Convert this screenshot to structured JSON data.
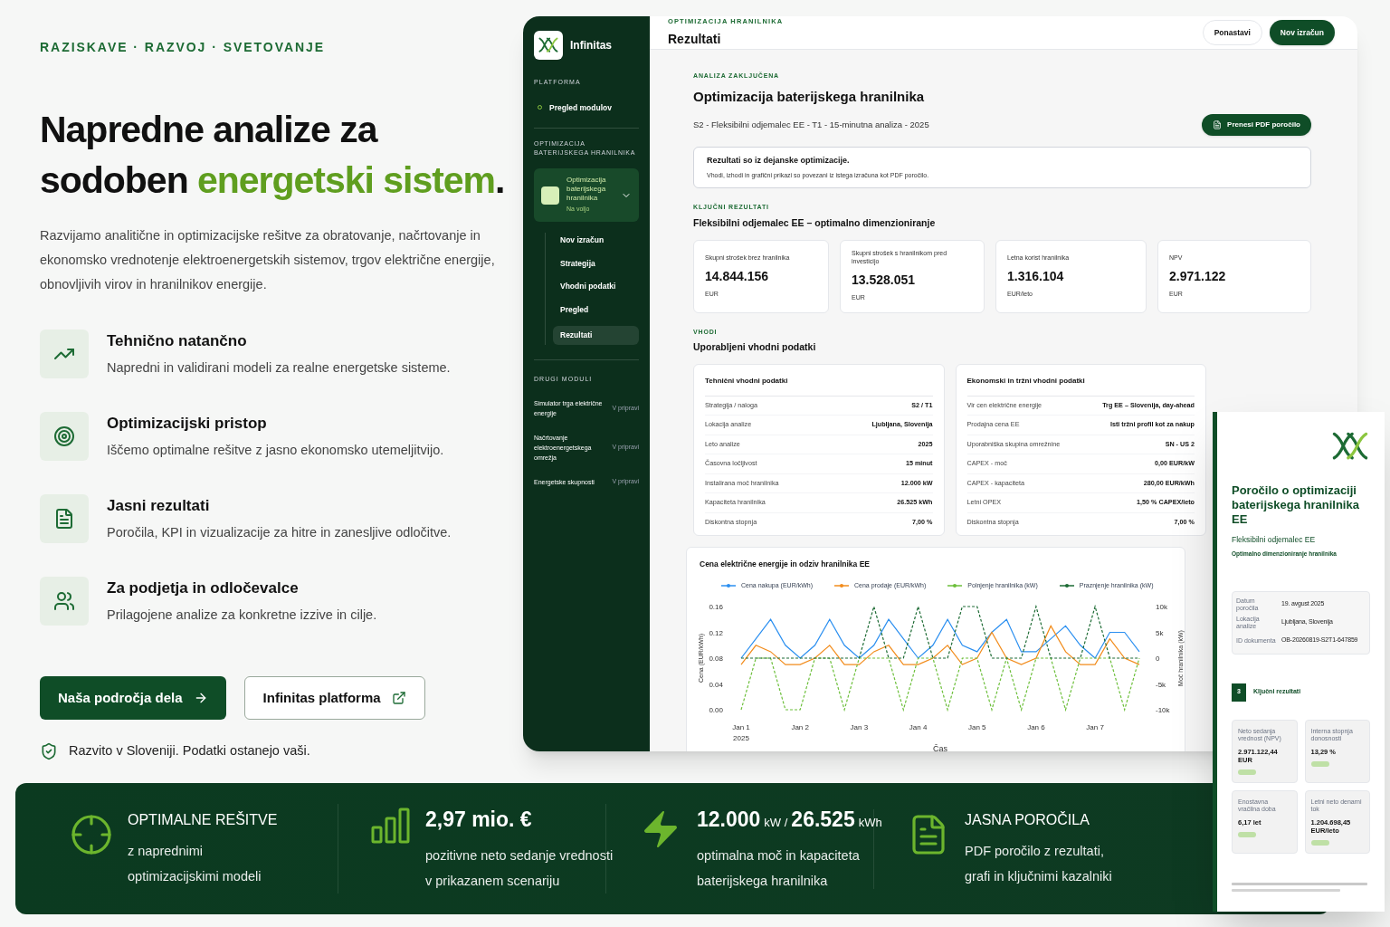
{
  "eyebrow": "RAZISKAVE · RAZVOJ · SVETOVANJE",
  "headline": [
    {
      "text": "Napredne analize za sodoben ",
      "kind": "plain"
    },
    {
      "text": "energetski sistem",
      "kind": "accent"
    },
    {
      "text": ".",
      "kind": "plain"
    }
  ],
  "intro": "Razvijamo analitične in optimizacijske rešitve za obratovanje, načrtovanje in ekonomsko vrednotenje elektroenergetskih sistemov, trgov električne energije, obnovljivih virov in hranilnikov energije.",
  "features": [
    {
      "title": "Tehnično natančno",
      "text": "Napredni in validirani modeli za realne energetske sisteme."
    },
    {
      "title": "Optimizacijski pristop",
      "text": "Iščemo optimalne rešitve z jasno ekonomsko utemeljitvijo."
    },
    {
      "title": "Jasni rezultati",
      "text": "Poročila, KPI in vizualizacije za hitre in zanesljive odločitve."
    },
    {
      "title": "Za podjetja in odločevalce",
      "text": "Prilagojene analize za konkretne izzive in cilje."
    }
  ],
  "buttons": [
    {
      "label": "Naša področja dela",
      "kind": "primary"
    },
    {
      "label": "Infinitas platforma",
      "kind": "secondary"
    }
  ],
  "note": "Razvito v Sloveniji. Podatki ostanejo vaši.",
  "app": {
    "brand": "Infinitas",
    "sidebar": {
      "platform_heading": "PLATFORMA",
      "platform_item": "Pregled modulov",
      "module_heading": "OPTIMIZACIJA BATERIJSKEGA HRANILNIKA",
      "module": {
        "title": "Optimizacija baterijskega hranilnika",
        "status": "Na voljo",
        "expanded": true
      },
      "steps": [
        {
          "label": "Nov izračun",
          "selected": false
        },
        {
          "label": "Strategija",
          "selected": false
        },
        {
          "label": "Vhodni podatki",
          "selected": false
        },
        {
          "label": "Pregled",
          "selected": false
        },
        {
          "label": "Rezultati",
          "selected": true
        }
      ],
      "other_heading": "DRUGI MODULI",
      "other_modules": [
        {
          "label": "Simulator trga električne energije",
          "status": "V pripravi"
        },
        {
          "label": "Načrtovanje elektroenergetskega omrežja",
          "status": "V pripravi"
        },
        {
          "label": "Energetske skupnosti",
          "status": "V pripravi"
        }
      ]
    },
    "header": {
      "eyebrow": "OPTIMIZACIJA HRANILNIKA",
      "title": "Rezultati",
      "buttons": [
        {
          "label": "Ponastavi",
          "kind": "secondary"
        },
        {
          "label": "Nov izračun",
          "kind": "primary"
        }
      ]
    },
    "status_label": "ANALIZA ZAKLJUČENA",
    "title": "Optimizacija baterijskega hranilnika",
    "subtitle": "S2 - Fleksibilni odjemalec EE - T1 - 15-minutna analiza - 2025",
    "download_button": "Prenesi PDF poročilo",
    "notice": {
      "title": "Rezultati so iz dejanske optimizacije.",
      "text": "Vhodi, izhodi in grafični prikazi so povezani iz istega izračuna kot PDF poročilo."
    },
    "kpi_label": "KLJUČNI REZULTATI",
    "kpi_heading": "Fleksibilni odjemalec EE – optimalno dimenzioniranje",
    "kpis": [
      {
        "label": "Skupni strošek brez hranilnika",
        "value": "14.844.156",
        "unit": "EUR"
      },
      {
        "label": "Skupni strošek s hranilnikom pred investicijo",
        "value": "13.528.051",
        "unit": "EUR"
      },
      {
        "label": "Letna korist hranilnika",
        "value": "1.316.104",
        "unit": "EUR/leto"
      },
      {
        "label": "NPV",
        "value": "2.971.122",
        "unit": "EUR"
      }
    ],
    "inputs_label": "VHODI",
    "inputs_heading": "Uporabljeni vhodni podatki",
    "tables": [
      {
        "title": "Tehnični vhodni podatki",
        "rows": [
          [
            "Strategija / naloga",
            "S2 / T1"
          ],
          [
            "Lokacija analize",
            "Ljubljana, Slovenija"
          ],
          [
            "Leto analize",
            "2025"
          ],
          [
            "Časovna ločljivost",
            "15 minut"
          ],
          [
            "Instalirana moč hranilnika",
            "12.000 kW"
          ],
          [
            "Kapaciteta hranilnika",
            "26.525 kWh"
          ],
          [
            "Diskontna stopnja",
            "7,00 %"
          ]
        ]
      },
      {
        "title": "Ekonomski in tržni vhodni podatki",
        "rows": [
          [
            "Vir cen električne energije",
            "Trg EE – Slovenija, day-ahead"
          ],
          [
            "Prodajna cena EE",
            "Isti tržni profil kot za nakup"
          ],
          [
            "Uporabniška skupina omrežnine",
            "SN - US 2"
          ],
          [
            "CAPEX - moč",
            "0,00 EUR/kW"
          ],
          [
            "CAPEX - kapaciteta",
            "280,00 EUR/kWh"
          ],
          [
            "Letni OPEX",
            "1,50 % CAPEX/leto"
          ],
          [
            "Diskontna stopnja",
            "7,00 %"
          ]
        ]
      }
    ],
    "chart": {
      "chart_data": {
        "type": "line",
        "title": "Cena električne energije in odziv hranilnika EE",
        "xlabel": "Čas",
        "ylabel": "Cena (EUR/kWh)",
        "y2label": "Moč hranilnika (kW)",
        "categories": [
          "Jan 1",
          null,
          null,
          null,
          "Jan 2",
          null,
          null,
          null,
          "Jan 3",
          null,
          null,
          null,
          "Jan 4",
          null,
          null,
          null,
          "Jan 5",
          null,
          null,
          null,
          "Jan 6",
          null,
          null,
          null,
          "Jan 7",
          null,
          null,
          null
        ],
        "annotations": [
          "2025"
        ],
        "legend": "top",
        "ylim": [
          0,
          0.16
        ],
        "y2lim": [
          -10000,
          10000
        ],
        "yticks": [
          {
            "value": 0,
            "label": "0.00"
          },
          {
            "value": 0.04,
            "label": "0.04"
          },
          {
            "value": 0.08,
            "label": "0.08"
          },
          {
            "value": 0.12,
            "label": "0.12"
          },
          {
            "value": 0.16,
            "label": "0.16"
          }
        ],
        "y2ticks": [
          {
            "value": -10000,
            "label": "-10k"
          },
          {
            "value": -5000,
            "label": "-5k"
          },
          {
            "value": 0,
            "label": "0"
          },
          {
            "value": 5000,
            "label": "5k"
          },
          {
            "value": 10000,
            "label": "10k"
          }
        ],
        "series": [
          {
            "name": "Cena nakupa (EUR/kWh)",
            "color": "#2b8ff0",
            "line_style": "solid",
            "values": [
              0.08,
              0.11,
              0.14,
              0.1,
              0.08,
              0.1,
              0.14,
              0.1,
              0.08,
              0.1,
              0.14,
              0.11,
              0.08,
              0.1,
              0.14,
              0.1,
              0.09,
              0.12,
              0.14,
              0.09,
              0.09,
              0.11,
              0.13,
              0.1,
              0.08,
              0.12,
              0.12,
              0.09
            ]
          },
          {
            "name": "Cena prodaje (EUR/kWh)",
            "color": "#f28c1c",
            "line_style": "solid",
            "values": [
              0.07,
              0.1,
              0.09,
              0.07,
              0.07,
              0.08,
              0.1,
              0.07,
              0.07,
              0.09,
              0.1,
              0.07,
              0.07,
              0.08,
              0.1,
              0.07,
              0.08,
              0.12,
              0.08,
              0.07,
              0.08,
              0.13,
              0.09,
              0.07,
              0.07,
              0.11,
              0.08,
              0.07
            ]
          },
          {
            "name": "Polnjenje hranilnika (kW)",
            "color": "#6cbf3a",
            "axis": "y2",
            "line_style": "dashed",
            "values": [
              -10000,
              0,
              0,
              -10000,
              -10000,
              0,
              0,
              -10000,
              0,
              0,
              0,
              -10000,
              0,
              0,
              -10000,
              0,
              0,
              -10000,
              0,
              -10000,
              0,
              0,
              -10000,
              0,
              0,
              0,
              -10000,
              0
            ]
          },
          {
            "name": "Praznjenje hranilnika (kW)",
            "color": "#1d6b34",
            "axis": "y2",
            "line_style": "dashed",
            "values": [
              0,
              0,
              0,
              0,
              0,
              0,
              0,
              0,
              0,
              10000,
              0,
              0,
              10000,
              0,
              0,
              10000,
              10000,
              0,
              0,
              0,
              10000,
              0,
              0,
              0,
              10000,
              0,
              0,
              0
            ]
          }
        ]
      }
    }
  },
  "report": {
    "title": "Poročilo o optimizaciji baterijskega hranilnika EE",
    "subtitle": "Fleksibilni odjemalec EE",
    "tagline": "Optimalno dimenzioniranje hranilnika",
    "meta": [
      [
        "Datum poročila",
        "19. avgust 2025"
      ],
      [
        "Lokacija analize",
        "Ljubljana, Slovenija"
      ],
      [
        "ID dokumenta",
        "OB-20260819-S2T1-647859"
      ]
    ],
    "section_number": "3",
    "section_title": "Ključni rezultati",
    "cards": [
      {
        "label": "Neto sedanja vrednost (NPV)",
        "value": "2.971.122,44 EUR"
      },
      {
        "label": "Interna stopnja donosnosti",
        "value": "13,29 %"
      },
      {
        "label": "Enostavna vračilna doba",
        "value": "6,17 let"
      },
      {
        "label": "Letni neto denarni tok",
        "value": "1.204.698,45 EUR/leto"
      }
    ]
  },
  "stats": [
    {
      "title": [
        {
          "text": "OPTIMALNE REŠITVE",
          "kind": "caps"
        }
      ],
      "lines": [
        "z naprednimi",
        "optimizacijskimi modeli"
      ]
    },
    {
      "title": [
        {
          "text": "2,97 mio. €",
          "kind": "big"
        }
      ],
      "lines": [
        "pozitivne neto sedanje vrednosti",
        "v prikazanem scenariju"
      ]
    },
    {
      "title": [
        {
          "text": "12.000",
          "kind": "big"
        },
        {
          "text": "kW /",
          "kind": "unit"
        },
        {
          "text": "26.525",
          "kind": "big"
        },
        {
          "text": "kWh",
          "kind": "unit"
        }
      ],
      "lines": [
        "optimalna moč in kapaciteta",
        "baterijskega hranilnika"
      ]
    },
    {
      "title": [
        {
          "text": "JASNA POROČILA",
          "kind": "caps"
        }
      ],
      "lines": [
        "PDF poročilo z rezultati,",
        "grafi in ključnimi kazalniki"
      ]
    }
  ]
}
